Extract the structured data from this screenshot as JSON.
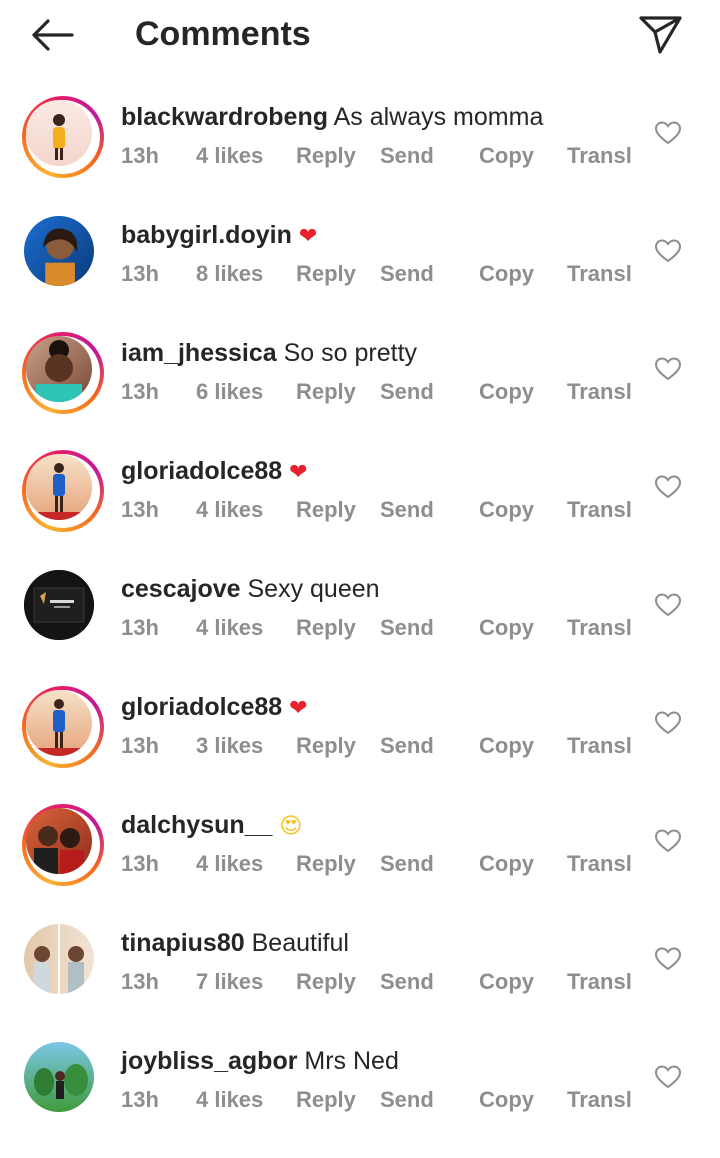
{
  "header": {
    "title": "Comments",
    "back_icon": "arrow-left-icon",
    "share_icon": "paper-plane-icon"
  },
  "actions": {
    "reply": "Reply",
    "send": "Send",
    "copy": "Copy",
    "translate": "Transl"
  },
  "comments": [
    {
      "username": "blackwardrobeng",
      "text": "As always momma",
      "emoji": "",
      "time": "13h",
      "likes": "4 likes",
      "story_ring": true
    },
    {
      "username": "babygirl.doyin",
      "text": "",
      "emoji": "❤",
      "time": "13h",
      "likes": "8 likes",
      "story_ring": false
    },
    {
      "username": "iam_jhessica",
      "text": "So so pretty",
      "emoji": "",
      "time": "13h",
      "likes": "6 likes",
      "story_ring": true
    },
    {
      "username": "gloriadolce88",
      "text": "",
      "emoji": "❤",
      "time": "13h",
      "likes": "4 likes",
      "story_ring": true
    },
    {
      "username": "cescajove",
      "text": "Sexy queen",
      "emoji": "",
      "time": "13h",
      "likes": "4 likes",
      "story_ring": false
    },
    {
      "username": "gloriadolce88",
      "text": "",
      "emoji": "❤",
      "time": "13h",
      "likes": "3 likes",
      "story_ring": true
    },
    {
      "username": "dalchysun__",
      "text": "",
      "emoji": "😍",
      "time": "13h",
      "likes": "4 likes",
      "story_ring": true
    },
    {
      "username": "tinapius80",
      "text": "Beautiful",
      "emoji": "",
      "time": "13h",
      "likes": "7 likes",
      "story_ring": false
    },
    {
      "username": "joybliss_agbor",
      "text": "Mrs Ned",
      "emoji": "",
      "time": "13h",
      "likes": "4 likes",
      "story_ring": false
    }
  ],
  "colors": {
    "text": "#262626",
    "meta": "#8e8e8e",
    "heart": "#e8212d"
  }
}
